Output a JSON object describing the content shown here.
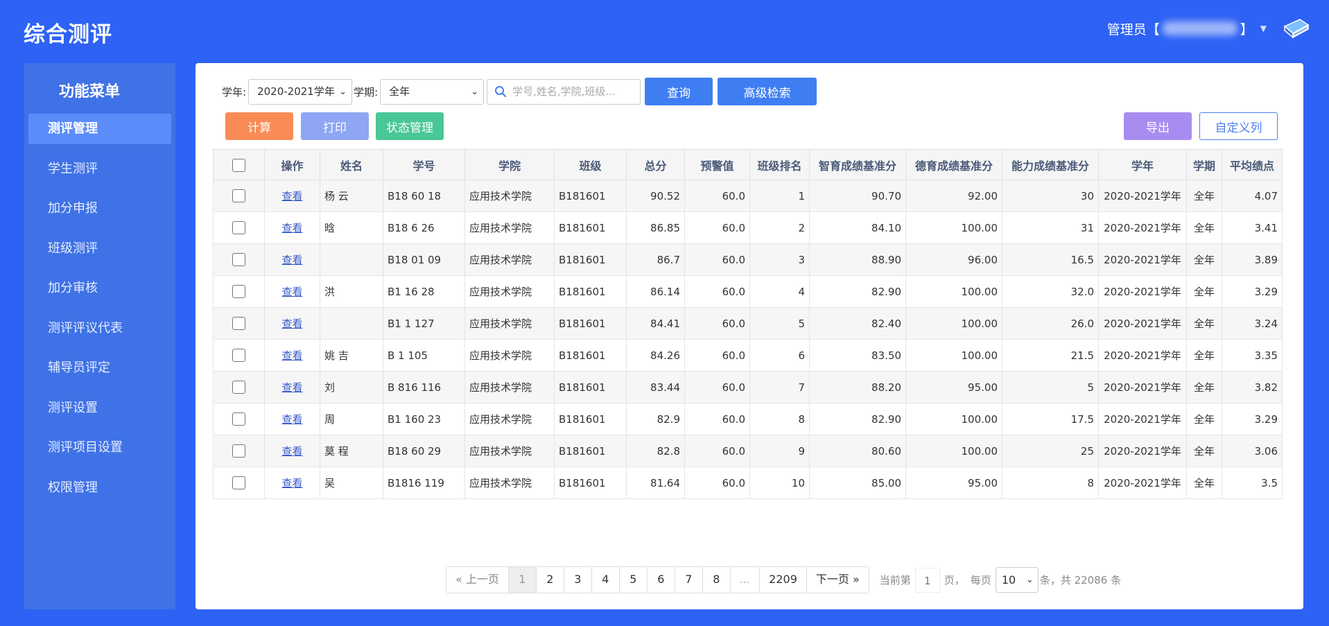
{
  "header": {
    "app_title": "综合测评",
    "user_prefix": "管理员【",
    "user_suffix": "】",
    "caret": "▼"
  },
  "sidebar": {
    "title": "功能菜单",
    "items": [
      {
        "label": "测评管理"
      },
      {
        "label": "学生测评"
      },
      {
        "label": "加分申报"
      },
      {
        "label": "班级测评"
      },
      {
        "label": "加分审核"
      },
      {
        "label": "测评评议代表"
      },
      {
        "label": "辅导员评定"
      },
      {
        "label": "测评设置"
      },
      {
        "label": "测评项目设置"
      },
      {
        "label": "权限管理"
      }
    ]
  },
  "filters": {
    "year_label": "学年:",
    "year_value": "2020-2021学年",
    "term_label": "学期:",
    "term_value": "全年",
    "search_placeholder": "学号,姓名,学院,班级...",
    "query_label": "查询",
    "advanced_label": "高级检索"
  },
  "actions": {
    "calc": "计算",
    "print": "打印",
    "status": "状态管理",
    "export": "导出",
    "custom_columns": "自定义列"
  },
  "table": {
    "columns": [
      "操作",
      "姓名",
      "学号",
      "学院",
      "班级",
      "总分",
      "预警值",
      "班级排名",
      "智育成绩基准分",
      "德育成绩基准分",
      "能力成绩基准分",
      "学年",
      "学期",
      "平均绩点"
    ],
    "rows": [
      {
        "action": "查看",
        "name": "杨  云",
        "id": "B18  60 18",
        "college": "应用技术学院",
        "class": "B181601",
        "total": "90.52",
        "warn": "60.0",
        "rank": "1",
        "zhiyu": "90.70",
        "deyu": "92.00",
        "nengli": "30",
        "year": "2020-2021学年",
        "term": "全年",
        "gpa": "4.07"
      },
      {
        "action": "查看",
        "name": "  晗",
        "id": "B18  6  26",
        "college": "应用技术学院",
        "class": "B181601",
        "total": "86.85",
        "warn": "60.0",
        "rank": "2",
        "zhiyu": "84.10",
        "deyu": "100.00",
        "nengli": "31",
        "year": "2020-2021学年",
        "term": "全年",
        "gpa": "3.41"
      },
      {
        "action": "查看",
        "name": "",
        "id": "B18  01  09",
        "college": "应用技术学院",
        "class": "B181601",
        "total": "86.7",
        "warn": "60.0",
        "rank": "3",
        "zhiyu": "88.90",
        "deyu": "96.00",
        "nengli": "16.5",
        "year": "2020-2021学年",
        "term": "全年",
        "gpa": "3.89"
      },
      {
        "action": "查看",
        "name": "洪",
        "id": "B1  16  28",
        "college": "应用技术学院",
        "class": "B181601",
        "total": "86.14",
        "warn": "60.0",
        "rank": "4",
        "zhiyu": "82.90",
        "deyu": "100.00",
        "nengli": "32.0",
        "year": "2020-2021学年",
        "term": "全年",
        "gpa": "3.29"
      },
      {
        "action": "查看",
        "name": "",
        "id": "B1  1  127",
        "college": "应用技术学院",
        "class": "B181601",
        "total": "84.41",
        "warn": "60.0",
        "rank": "5",
        "zhiyu": "82.40",
        "deyu": "100.00",
        "nengli": "26.0",
        "year": "2020-2021学年",
        "term": "全年",
        "gpa": "3.24"
      },
      {
        "action": "查看",
        "name": "姚  吉",
        "id": "B  1  105",
        "college": "应用技术学院",
        "class": "B181601",
        "total": "84.26",
        "warn": "60.0",
        "rank": "6",
        "zhiyu": "83.50",
        "deyu": "100.00",
        "nengli": "21.5",
        "year": "2020-2021学年",
        "term": "全年",
        "gpa": "3.35"
      },
      {
        "action": "查看",
        "name": "刘",
        "id": "B  816  116",
        "college": "应用技术学院",
        "class": "B181601",
        "total": "83.44",
        "warn": "60.0",
        "rank": "7",
        "zhiyu": "88.20",
        "deyu": "95.00",
        "nengli": "5",
        "year": "2020-2021学年",
        "term": "全年",
        "gpa": "3.82"
      },
      {
        "action": "查看",
        "name": "周",
        "id": "B1  160  23",
        "college": "应用技术学院",
        "class": "B181601",
        "total": "82.9",
        "warn": "60.0",
        "rank": "8",
        "zhiyu": "82.90",
        "deyu": "100.00",
        "nengli": "17.5",
        "year": "2020-2021学年",
        "term": "全年",
        "gpa": "3.29"
      },
      {
        "action": "查看",
        "name": "莫  程",
        "id": "B18  60  29",
        "college": "应用技术学院",
        "class": "B181601",
        "total": "82.8",
        "warn": "60.0",
        "rank": "9",
        "zhiyu": "80.60",
        "deyu": "100.00",
        "nengli": "25",
        "year": "2020-2021学年",
        "term": "全年",
        "gpa": "3.06"
      },
      {
        "action": "查看",
        "name": "吴",
        "id": "B1816  119",
        "college": "应用技术学院",
        "class": "B181601",
        "total": "81.64",
        "warn": "60.0",
        "rank": "10",
        "zhiyu": "85.00",
        "deyu": "95.00",
        "nengli": "8",
        "year": "2020-2021学年",
        "term": "全年",
        "gpa": "3.5"
      }
    ]
  },
  "pagination": {
    "prev": "« 上一页",
    "pages": [
      "1",
      "2",
      "3",
      "4",
      "5",
      "6",
      "7",
      "8"
    ],
    "ellipsis": "...",
    "last_page": "2209",
    "next": "下一页 »",
    "current_label": "当前第",
    "current_page": "1",
    "page_unit": "页，",
    "per_page_label": "每页",
    "per_page_value": "10",
    "total_text": "条，共 22086 条"
  }
}
